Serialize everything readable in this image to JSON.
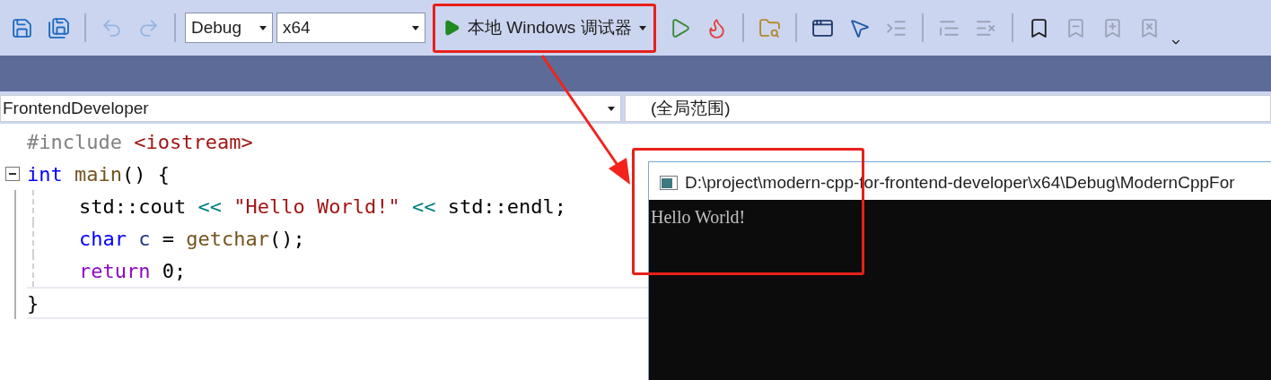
{
  "toolbar": {
    "items": [
      {
        "kind": "save",
        "disabled": false
      },
      {
        "kind": "save-all",
        "disabled": false
      },
      {
        "kind": "separator"
      },
      {
        "kind": "undo",
        "disabled": true
      },
      {
        "kind": "redo",
        "disabled": true
      },
      {
        "kind": "separator"
      },
      {
        "kind": "config",
        "value": "Debug"
      },
      {
        "kind": "platform",
        "value": "x64"
      },
      {
        "kind": "debug",
        "label": "本地 Windows 调试器"
      },
      {
        "kind": "run",
        "disabled": false
      },
      {
        "kind": "hot-reload",
        "disabled": false
      },
      {
        "kind": "separator"
      },
      {
        "kind": "find-folder",
        "disabled": false
      },
      {
        "kind": "separator"
      },
      {
        "kind": "window",
        "disabled": false
      },
      {
        "kind": "cursor",
        "disabled": false
      },
      {
        "kind": "indent",
        "disabled": true
      },
      {
        "kind": "separator"
      },
      {
        "kind": "comment",
        "disabled": true
      },
      {
        "kind": "uncomment",
        "disabled": true
      },
      {
        "kind": "separator"
      },
      {
        "kind": "bookmark",
        "disabled": false
      },
      {
        "kind": "bookmark-prev",
        "disabled": true
      },
      {
        "kind": "bookmark-next",
        "disabled": true
      },
      {
        "kind": "bookmark-clear",
        "disabled": true
      },
      {
        "kind": "overflow"
      }
    ]
  },
  "navigation": {
    "project": "FrontendDeveloper",
    "scope": "(全局范围)"
  },
  "editor": {
    "lines": [
      {
        "tokens": [
          {
            "text": "#include ",
            "kind": "preprocessor"
          },
          {
            "text": "<iostream>",
            "kind": "string"
          }
        ]
      },
      {
        "fold": true,
        "tokens": [
          {
            "text": "int ",
            "kind": "keyword"
          },
          {
            "text": "main",
            "kind": "function"
          },
          {
            "text": "() {",
            "kind": "plain"
          }
        ],
        "children": [
          {
            "tokens": [
              {
                "text": "std::cout ",
                "kind": "plain"
              },
              {
                "text": "<< ",
                "kind": "operator"
              },
              {
                "text": "\"Hello World!\" ",
                "kind": "string"
              },
              {
                "text": "<<",
                "kind": "operator"
              },
              {
                "text": " std::endl;",
                "kind": "plain"
              }
            ]
          },
          {
            "tokens": [
              {
                "text": "char ",
                "kind": "keyword"
              },
              {
                "text": "c",
                "kind": "variable"
              },
              {
                "text": " = ",
                "kind": "plain"
              },
              {
                "text": "getchar",
                "kind": "function"
              },
              {
                "text": "();",
                "kind": "plain"
              }
            ]
          },
          {
            "tokens": [
              {
                "text": "return",
                "kind": "control"
              },
              {
                "text": " 0;",
                "kind": "plain"
              }
            ]
          }
        ]
      },
      {
        "current": true,
        "tokens": [
          {
            "text": "}",
            "kind": "plain"
          }
        ]
      }
    ]
  },
  "console": {
    "title": "D:\\project\\modern-cpp-for-frontend-developer\\x64\\Debug\\ModernCppFor",
    "output": "Hello World!"
  }
}
